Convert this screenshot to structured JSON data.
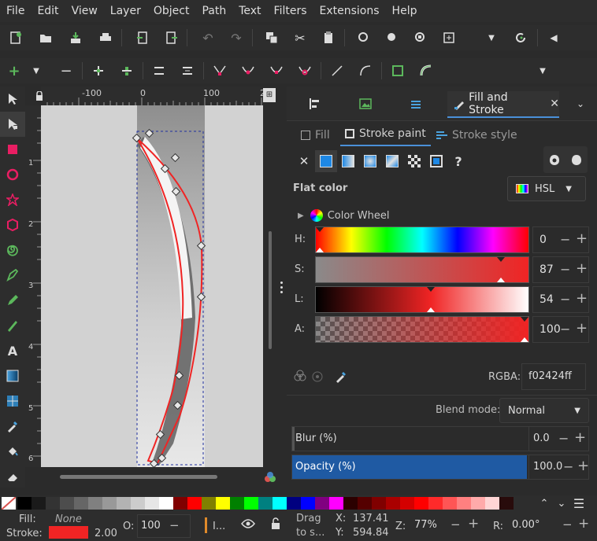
{
  "menu": [
    "File",
    "Edit",
    "View",
    "Layer",
    "Object",
    "Path",
    "Text",
    "Filters",
    "Extensions",
    "Help"
  ],
  "ruler": {
    "ticks": [
      "-100",
      "0",
      "100",
      "2"
    ],
    "vticks": [
      "1",
      "2",
      "3",
      "4",
      "5",
      "6"
    ]
  },
  "dock": {
    "active_tab_label": "Fill and Stroke",
    "subtabs": {
      "fill": "Fill",
      "stroke_paint": "Stroke paint",
      "stroke_style": "Stroke style"
    },
    "paint_mode_label": "Flat color",
    "color_model": "HSL",
    "color_wheel_label": "Color Wheel",
    "channels": [
      {
        "key": "H:",
        "value": "0",
        "position": 0.0
      },
      {
        "key": "S:",
        "value": "87",
        "position": 0.87
      },
      {
        "key": "L:",
        "value": "54",
        "position": 0.54
      },
      {
        "key": "A:",
        "value": "100",
        "position": 1.0
      }
    ],
    "rgba_label": "RGBA:",
    "rgba_value": "f02424ff",
    "blend_label": "Blend mode:",
    "blend_value": "Normal",
    "blur_label": "Blur (%)",
    "blur_value": "0.0",
    "opacity_label": "Opacity (%)",
    "opacity_value": "100.0"
  },
  "status": {
    "fill_label": "Fill:",
    "fill_value": "None",
    "stroke_label": "Stroke:",
    "stroke_width": "2.00",
    "o_label": "O:",
    "o_value": "100",
    "layer_label": "I...",
    "drag_hint_1": "Drag",
    "drag_hint_2": "to s...",
    "x_label": "X:",
    "x_value": "137.41",
    "y_label": "Y:",
    "y_value": "594.84",
    "z_label": "Z:",
    "zoom_value": "77%",
    "r_label": "R:",
    "rotation_value": "0.00°"
  },
  "colors": {
    "accent": "#4a90d9",
    "stroke_color": "#f02424",
    "opacity_bg": "#1f5aa3"
  },
  "palette": [
    "#000000",
    "#1a1a1a",
    "#333333",
    "#4d4d4d",
    "#666666",
    "#808080",
    "#999999",
    "#b3b3b3",
    "#cccccc",
    "#e6e6e6",
    "#ffffff",
    "#800000",
    "#ff0000",
    "#808000",
    "#ffff00",
    "#008000",
    "#00ff00",
    "#008080",
    "#00ffff",
    "#000080",
    "#0000ff",
    "#800080",
    "#ff00ff",
    "#2b0000",
    "#550000",
    "#800000",
    "#aa0000",
    "#d40000",
    "#ff0000",
    "#ff2a2a",
    "#ff5555",
    "#ff8080",
    "#ffaaaa",
    "#ffd5d5",
    "#280b0b"
  ]
}
